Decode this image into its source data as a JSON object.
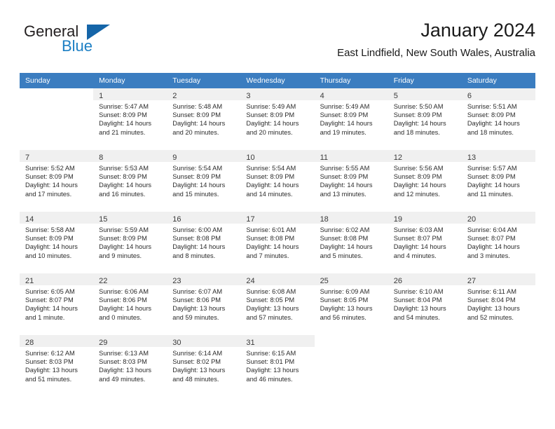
{
  "brand": {
    "name_top": "General",
    "name_bottom": "Blue",
    "triangle_icon": "triangle-icon",
    "color_dark": "#231f20",
    "color_blue": "#1c7fc4"
  },
  "header": {
    "title": "January 2024",
    "subtitle": "East Lindfield, New South Wales, Australia"
  },
  "theme": {
    "header_row_bg": "#3b7dc0",
    "header_row_text": "#ffffff",
    "shaded_cell_bg": "#f0f0f0",
    "grid_line": "#cfcfcf"
  },
  "weekdays": [
    "Sunday",
    "Monday",
    "Tuesday",
    "Wednesday",
    "Thursday",
    "Friday",
    "Saturday"
  ],
  "weeks": [
    [
      {
        "day": "",
        "sunrise": "",
        "sunset": "",
        "daylight_line1": "",
        "daylight_line2": "",
        "empty": true
      },
      {
        "day": "1",
        "sunrise": "Sunrise: 5:47 AM",
        "sunset": "Sunset: 8:09 PM",
        "daylight_line1": "Daylight: 14 hours",
        "daylight_line2": "and 21 minutes."
      },
      {
        "day": "2",
        "sunrise": "Sunrise: 5:48 AM",
        "sunset": "Sunset: 8:09 PM",
        "daylight_line1": "Daylight: 14 hours",
        "daylight_line2": "and 20 minutes."
      },
      {
        "day": "3",
        "sunrise": "Sunrise: 5:49 AM",
        "sunset": "Sunset: 8:09 PM",
        "daylight_line1": "Daylight: 14 hours",
        "daylight_line2": "and 20 minutes."
      },
      {
        "day": "4",
        "sunrise": "Sunrise: 5:49 AM",
        "sunset": "Sunset: 8:09 PM",
        "daylight_line1": "Daylight: 14 hours",
        "daylight_line2": "and 19 minutes."
      },
      {
        "day": "5",
        "sunrise": "Sunrise: 5:50 AM",
        "sunset": "Sunset: 8:09 PM",
        "daylight_line1": "Daylight: 14 hours",
        "daylight_line2": "and 18 minutes."
      },
      {
        "day": "6",
        "sunrise": "Sunrise: 5:51 AM",
        "sunset": "Sunset: 8:09 PM",
        "daylight_line1": "Daylight: 14 hours",
        "daylight_line2": "and 18 minutes."
      }
    ],
    [
      {
        "day": "7",
        "sunrise": "Sunrise: 5:52 AM",
        "sunset": "Sunset: 8:09 PM",
        "daylight_line1": "Daylight: 14 hours",
        "daylight_line2": "and 17 minutes."
      },
      {
        "day": "8",
        "sunrise": "Sunrise: 5:53 AM",
        "sunset": "Sunset: 8:09 PM",
        "daylight_line1": "Daylight: 14 hours",
        "daylight_line2": "and 16 minutes."
      },
      {
        "day": "9",
        "sunrise": "Sunrise: 5:54 AM",
        "sunset": "Sunset: 8:09 PM",
        "daylight_line1": "Daylight: 14 hours",
        "daylight_line2": "and 15 minutes."
      },
      {
        "day": "10",
        "sunrise": "Sunrise: 5:54 AM",
        "sunset": "Sunset: 8:09 PM",
        "daylight_line1": "Daylight: 14 hours",
        "daylight_line2": "and 14 minutes."
      },
      {
        "day": "11",
        "sunrise": "Sunrise: 5:55 AM",
        "sunset": "Sunset: 8:09 PM",
        "daylight_line1": "Daylight: 14 hours",
        "daylight_line2": "and 13 minutes."
      },
      {
        "day": "12",
        "sunrise": "Sunrise: 5:56 AM",
        "sunset": "Sunset: 8:09 PM",
        "daylight_line1": "Daylight: 14 hours",
        "daylight_line2": "and 12 minutes."
      },
      {
        "day": "13",
        "sunrise": "Sunrise: 5:57 AM",
        "sunset": "Sunset: 8:09 PM",
        "daylight_line1": "Daylight: 14 hours",
        "daylight_line2": "and 11 minutes."
      }
    ],
    [
      {
        "day": "14",
        "sunrise": "Sunrise: 5:58 AM",
        "sunset": "Sunset: 8:09 PM",
        "daylight_line1": "Daylight: 14 hours",
        "daylight_line2": "and 10 minutes."
      },
      {
        "day": "15",
        "sunrise": "Sunrise: 5:59 AM",
        "sunset": "Sunset: 8:09 PM",
        "daylight_line1": "Daylight: 14 hours",
        "daylight_line2": "and 9 minutes."
      },
      {
        "day": "16",
        "sunrise": "Sunrise: 6:00 AM",
        "sunset": "Sunset: 8:08 PM",
        "daylight_line1": "Daylight: 14 hours",
        "daylight_line2": "and 8 minutes."
      },
      {
        "day": "17",
        "sunrise": "Sunrise: 6:01 AM",
        "sunset": "Sunset: 8:08 PM",
        "daylight_line1": "Daylight: 14 hours",
        "daylight_line2": "and 7 minutes."
      },
      {
        "day": "18",
        "sunrise": "Sunrise: 6:02 AM",
        "sunset": "Sunset: 8:08 PM",
        "daylight_line1": "Daylight: 14 hours",
        "daylight_line2": "and 5 minutes."
      },
      {
        "day": "19",
        "sunrise": "Sunrise: 6:03 AM",
        "sunset": "Sunset: 8:07 PM",
        "daylight_line1": "Daylight: 14 hours",
        "daylight_line2": "and 4 minutes."
      },
      {
        "day": "20",
        "sunrise": "Sunrise: 6:04 AM",
        "sunset": "Sunset: 8:07 PM",
        "daylight_line1": "Daylight: 14 hours",
        "daylight_line2": "and 3 minutes."
      }
    ],
    [
      {
        "day": "21",
        "sunrise": "Sunrise: 6:05 AM",
        "sunset": "Sunset: 8:07 PM",
        "daylight_line1": "Daylight: 14 hours",
        "daylight_line2": "and 1 minute."
      },
      {
        "day": "22",
        "sunrise": "Sunrise: 6:06 AM",
        "sunset": "Sunset: 8:06 PM",
        "daylight_line1": "Daylight: 14 hours",
        "daylight_line2": "and 0 minutes."
      },
      {
        "day": "23",
        "sunrise": "Sunrise: 6:07 AM",
        "sunset": "Sunset: 8:06 PM",
        "daylight_line1": "Daylight: 13 hours",
        "daylight_line2": "and 59 minutes."
      },
      {
        "day": "24",
        "sunrise": "Sunrise: 6:08 AM",
        "sunset": "Sunset: 8:05 PM",
        "daylight_line1": "Daylight: 13 hours",
        "daylight_line2": "and 57 minutes."
      },
      {
        "day": "25",
        "sunrise": "Sunrise: 6:09 AM",
        "sunset": "Sunset: 8:05 PM",
        "daylight_line1": "Daylight: 13 hours",
        "daylight_line2": "and 56 minutes."
      },
      {
        "day": "26",
        "sunrise": "Sunrise: 6:10 AM",
        "sunset": "Sunset: 8:04 PM",
        "daylight_line1": "Daylight: 13 hours",
        "daylight_line2": "and 54 minutes."
      },
      {
        "day": "27",
        "sunrise": "Sunrise: 6:11 AM",
        "sunset": "Sunset: 8:04 PM",
        "daylight_line1": "Daylight: 13 hours",
        "daylight_line2": "and 52 minutes."
      }
    ],
    [
      {
        "day": "28",
        "sunrise": "Sunrise: 6:12 AM",
        "sunset": "Sunset: 8:03 PM",
        "daylight_line1": "Daylight: 13 hours",
        "daylight_line2": "and 51 minutes."
      },
      {
        "day": "29",
        "sunrise": "Sunrise: 6:13 AM",
        "sunset": "Sunset: 8:03 PM",
        "daylight_line1": "Daylight: 13 hours",
        "daylight_line2": "and 49 minutes."
      },
      {
        "day": "30",
        "sunrise": "Sunrise: 6:14 AM",
        "sunset": "Sunset: 8:02 PM",
        "daylight_line1": "Daylight: 13 hours",
        "daylight_line2": "and 48 minutes."
      },
      {
        "day": "31",
        "sunrise": "Sunrise: 6:15 AM",
        "sunset": "Sunset: 8:01 PM",
        "daylight_line1": "Daylight: 13 hours",
        "daylight_line2": "and 46 minutes."
      },
      {
        "day": "",
        "sunrise": "",
        "sunset": "",
        "daylight_line1": "",
        "daylight_line2": "",
        "empty": true
      },
      {
        "day": "",
        "sunrise": "",
        "sunset": "",
        "daylight_line1": "",
        "daylight_line2": "",
        "empty": true
      },
      {
        "day": "",
        "sunrise": "",
        "sunset": "",
        "daylight_line1": "",
        "daylight_line2": "",
        "empty": true
      }
    ]
  ]
}
